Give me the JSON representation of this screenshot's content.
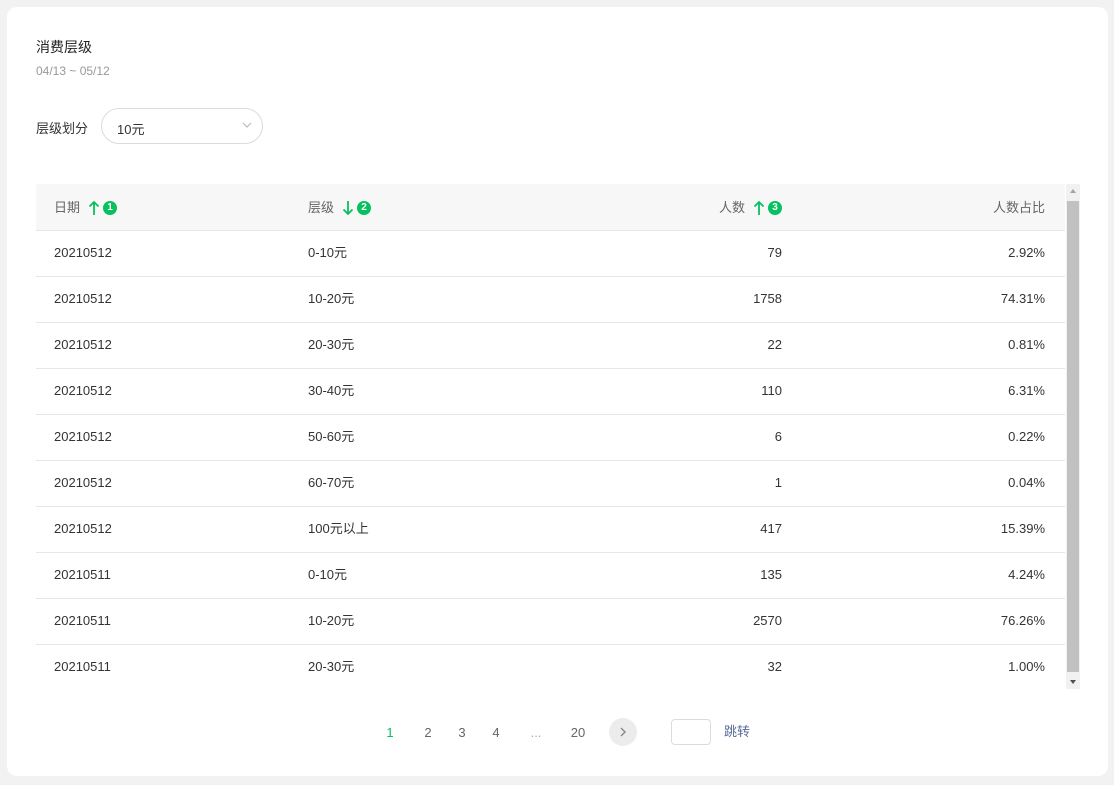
{
  "title": "消费层级",
  "date_range": "04/13 ~ 05/12",
  "filter": {
    "label": "层级划分",
    "selected": "10元"
  },
  "table": {
    "headers": [
      {
        "label": "日期",
        "sort": "asc",
        "priority": "1"
      },
      {
        "label": "层级",
        "sort": "desc",
        "priority": "2"
      },
      {
        "label": "人数",
        "sort": "asc",
        "priority": "3"
      },
      {
        "label": "人数占比"
      }
    ],
    "rows": [
      [
        "20210512",
        "0-10元",
        "79",
        "2.92%"
      ],
      [
        "20210512",
        "10-20元",
        "1758",
        "74.31%"
      ],
      [
        "20210512",
        "20-30元",
        "22",
        "0.81%"
      ],
      [
        "20210512",
        "30-40元",
        "110",
        "6.31%"
      ],
      [
        "20210512",
        "50-60元",
        "6",
        "0.22%"
      ],
      [
        "20210512",
        "60-70元",
        "1",
        "0.04%"
      ],
      [
        "20210512",
        "100元以上",
        "417",
        "15.39%"
      ],
      [
        "20210511",
        "0-10元",
        "135",
        "4.24%"
      ],
      [
        "20210511",
        "10-20元",
        "2570",
        "76.26%"
      ],
      [
        "20210511",
        "20-30元",
        "32",
        "1.00%"
      ]
    ]
  },
  "pagination": {
    "pages": [
      "1",
      "2",
      "3",
      "4",
      "...",
      "20"
    ],
    "current": "1",
    "jump_label": "跳转"
  },
  "colors": {
    "accent": "#07c160",
    "link": "#576b95"
  }
}
